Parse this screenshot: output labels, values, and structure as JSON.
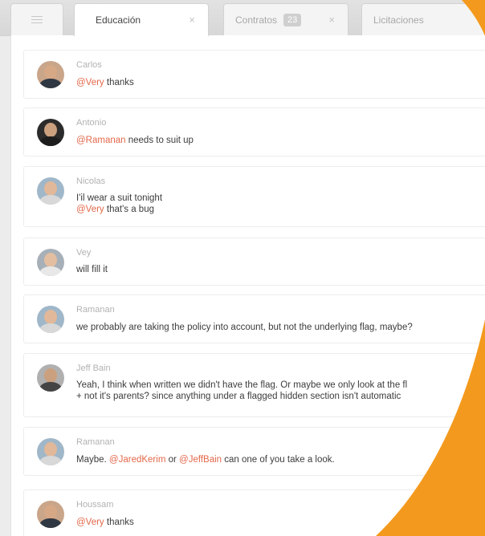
{
  "tabs": {
    "list_icon": "list-icon",
    "education": {
      "label": "Educación",
      "close": "×"
    },
    "contracts": {
      "label": "Contratos",
      "badge": "23",
      "close": "×"
    },
    "tenders": {
      "label": "Licitaciones"
    }
  },
  "messages": [
    {
      "author": "Carlos",
      "mention": "@Very",
      "text": " thanks"
    },
    {
      "author": "Antonio",
      "mention": "@Ramanan",
      "text": " needs to suit up"
    },
    {
      "author": "Nicolas",
      "line1": "I'il wear a suit tonight",
      "mention": "@Very",
      "text": " that's a bug"
    },
    {
      "author": "Vey",
      "text": "will fill it"
    },
    {
      "author": "Ramanan",
      "text": "we probably are taking the policy into account, but not the underlying flag, maybe?"
    },
    {
      "author": "Jeff Bain",
      "line1": "Yeah, I think when written we didn't have the flag. Or maybe we only look at the fl",
      "line2": "+ not it's parents? since anything under a flagged hidden section isn't automatic"
    },
    {
      "author": "Ramanan",
      "prefix": "Maybe. ",
      "mention1": "@JaredKerim",
      "middle": " or ",
      "mention2": "@JeffBain",
      "suffix": " can one of you take a look."
    },
    {
      "author": "Houssam",
      "mention": "@Very",
      "text": " thanks"
    }
  ],
  "colors": {
    "accent_orange": "#f39a1e",
    "mention": "#e3684a"
  }
}
